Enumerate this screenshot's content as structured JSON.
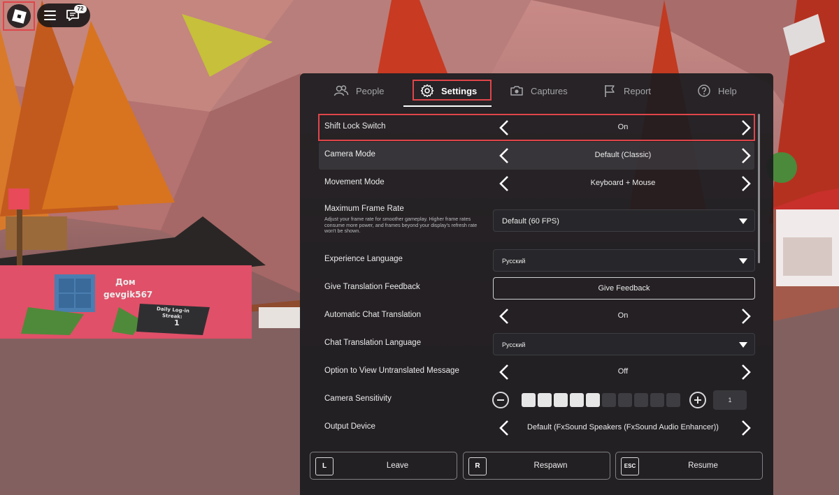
{
  "hud": {
    "notification_count": "72"
  },
  "scene": {
    "house_sign": "Дом",
    "player_name": "gevgik567",
    "streak_line1": "Daily Log-in",
    "streak_line2": "Streak:",
    "streak_count": "1"
  },
  "tabs": [
    {
      "label": "People",
      "icon": "people-icon"
    },
    {
      "label": "Settings",
      "icon": "gear-icon",
      "active": true
    },
    {
      "label": "Captures",
      "icon": "camera-icon"
    },
    {
      "label": "Report",
      "icon": "flag-icon"
    },
    {
      "label": "Help",
      "icon": "help-icon"
    }
  ],
  "settings": {
    "shift_lock": {
      "label": "Shift Lock Switch",
      "value": "On"
    },
    "camera_mode": {
      "label": "Camera Mode",
      "value": "Default (Classic)"
    },
    "movement_mode": {
      "label": "Movement Mode",
      "value": "Keyboard + Mouse"
    },
    "frame_rate": {
      "label": "Maximum Frame Rate",
      "description": "Adjust your frame rate for smoother gameplay. Higher frame rates consume more power, and frames beyond your display's refresh rate won't be shown.",
      "value": "Default (60 FPS)"
    },
    "experience_language": {
      "label": "Experience Language",
      "value": "Русский"
    },
    "translation_feedback": {
      "label": "Give Translation Feedback",
      "button": "Give Feedback"
    },
    "auto_chat_translation": {
      "label": "Automatic Chat Translation",
      "value": "On"
    },
    "chat_translation_language": {
      "label": "Chat Translation Language",
      "value": "Русский"
    },
    "untranslated_option": {
      "label": "Option to View Untranslated Message",
      "value": "Off"
    },
    "camera_sensitivity": {
      "label": "Camera Sensitivity",
      "value": "1",
      "level": 5,
      "max": 10
    },
    "output_device": {
      "label": "Output Device",
      "value": "Default (FxSound Speakers (FxSound Audio Enhancer))"
    }
  },
  "bottom_buttons": {
    "leave": {
      "key": "L",
      "label": "Leave"
    },
    "respawn": {
      "key": "R",
      "label": "Respawn"
    },
    "resume": {
      "key": "ESC",
      "label": "Resume"
    }
  },
  "colors": {
    "highlight": "#e0454a",
    "panel": "#1c1c1f"
  }
}
